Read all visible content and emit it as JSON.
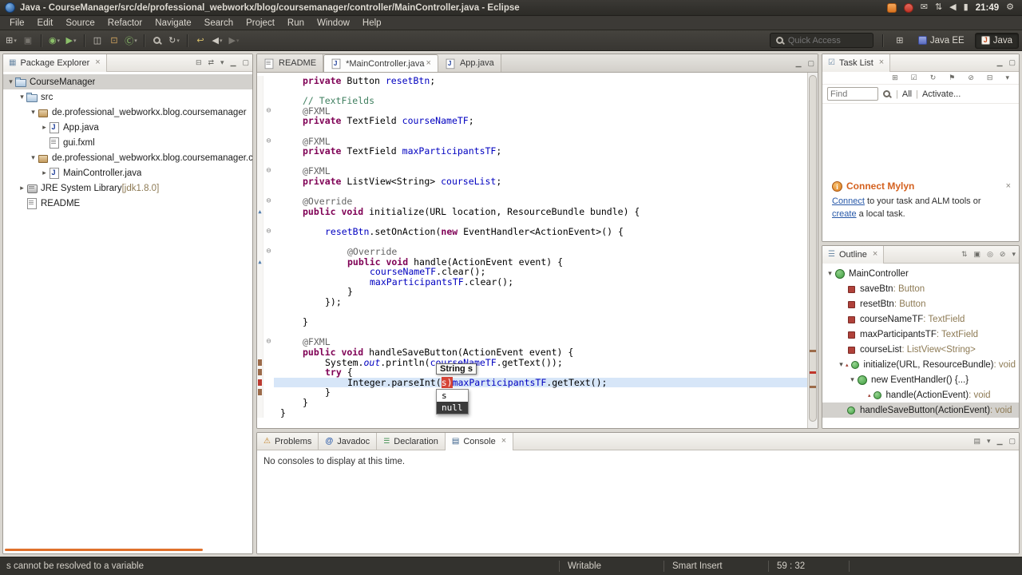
{
  "window": {
    "title": "Java - CourseManager/src/de/professional_webworkx/blog/coursemanager/controller/MainController.java - Eclipse",
    "clock": "21:49"
  },
  "menubar": {
    "items": [
      "File",
      "Edit",
      "Source",
      "Refactor",
      "Navigate",
      "Search",
      "Project",
      "Run",
      "Window",
      "Help"
    ]
  },
  "toolbar": {
    "quick_access_placeholder": "Quick Access",
    "perspectives": [
      {
        "label": "Java EE"
      },
      {
        "label": "Java"
      }
    ]
  },
  "package_explorer": {
    "title": "Package Explorer",
    "items": [
      {
        "label": "CourseManager",
        "icon": "project",
        "depth": 0,
        "expander": "down",
        "selected": true
      },
      {
        "label": "src",
        "icon": "src",
        "depth": 1,
        "expander": "down"
      },
      {
        "label": "de.professional_webworkx.blog.coursemanager",
        "icon": "package",
        "depth": 2,
        "expander": "down"
      },
      {
        "label": "App.java",
        "icon": "java",
        "depth": 3,
        "expander": "right"
      },
      {
        "label": "gui.fxml",
        "icon": "file",
        "depth": 3
      },
      {
        "label": "de.professional_webworkx.blog.coursemanager.controller",
        "icon": "package",
        "depth": 2,
        "expander": "down"
      },
      {
        "label": "MainController.java",
        "icon": "java",
        "depth": 3,
        "expander": "right"
      },
      {
        "label": "JRE System Library",
        "deco": " [jdk1.8.0]",
        "icon": "library",
        "depth": 1,
        "expander": "right"
      },
      {
        "label": "README",
        "icon": "file",
        "depth": 1
      }
    ]
  },
  "editor": {
    "tabs": [
      {
        "label": "README",
        "icon": "file"
      },
      {
        "label": "*MainController.java",
        "icon": "java",
        "active": true,
        "closable": true
      },
      {
        "label": "App.java",
        "icon": "java"
      }
    ],
    "assist": {
      "tooltip": "String s",
      "items": [
        {
          "label": "s"
        },
        {
          "label": "null",
          "selected": true
        }
      ]
    },
    "lines": [
      {
        "ind": 1,
        "t": [
          [
            "k",
            "private "
          ],
          [
            "pl",
            "Button "
          ],
          [
            "f",
            "resetBtn"
          ],
          [
            "pl",
            ";"
          ]
        ]
      },
      {
        "t": []
      },
      {
        "ind": 1,
        "t": [
          [
            "c",
            "// TextFields"
          ]
        ]
      },
      {
        "ind": 1,
        "fold": true,
        "t": [
          [
            "a",
            "@FXML"
          ]
        ]
      },
      {
        "ind": 1,
        "t": [
          [
            "k",
            "private "
          ],
          [
            "pl",
            "TextField "
          ],
          [
            "f",
            "courseNameTF"
          ],
          [
            "pl",
            ";"
          ]
        ]
      },
      {
        "t": []
      },
      {
        "ind": 1,
        "fold": true,
        "t": [
          [
            "a",
            "@FXML"
          ]
        ]
      },
      {
        "ind": 1,
        "t": [
          [
            "k",
            "private "
          ],
          [
            "pl",
            "TextField "
          ],
          [
            "f",
            "maxParticipantsTF"
          ],
          [
            "pl",
            ";"
          ]
        ]
      },
      {
        "t": []
      },
      {
        "ind": 1,
        "fold": true,
        "t": [
          [
            "a",
            "@FXML"
          ]
        ]
      },
      {
        "ind": 1,
        "t": [
          [
            "k",
            "private "
          ],
          [
            "pl",
            "ListView<String> "
          ],
          [
            "f",
            "courseList"
          ],
          [
            "pl",
            ";"
          ]
        ]
      },
      {
        "t": []
      },
      {
        "ind": 1,
        "fold": true,
        "t": [
          [
            "a",
            "@Override"
          ]
        ]
      },
      {
        "ind": 1,
        "ovr": true,
        "t": [
          [
            "k",
            "public void "
          ],
          [
            "pl",
            "initialize(URL location, ResourceBundle bundle) {"
          ]
        ]
      },
      {
        "t": []
      },
      {
        "ind": 2,
        "fold": true,
        "t": [
          [
            "f",
            "resetBtn"
          ],
          [
            "pl",
            ".setOnAction("
          ],
          [
            "k",
            "new"
          ],
          [
            "pl",
            " EventHandler<ActionEvent>() {"
          ]
        ]
      },
      {
        "t": []
      },
      {
        "ind": 3,
        "fold": true,
        "t": [
          [
            "a",
            "@Override"
          ]
        ]
      },
      {
        "ind": 3,
        "ovr": true,
        "t": [
          [
            "k",
            "public void "
          ],
          [
            "pl",
            "handle(ActionEvent event) {"
          ]
        ]
      },
      {
        "ind": 4,
        "t": [
          [
            "f",
            "courseNameTF"
          ],
          [
            "pl",
            ".clear();"
          ]
        ]
      },
      {
        "ind": 4,
        "t": [
          [
            "f",
            "maxParticipantsTF"
          ],
          [
            "pl",
            ".clear();"
          ]
        ]
      },
      {
        "ind": 3,
        "t": [
          [
            "pl",
            "}"
          ]
        ]
      },
      {
        "ind": 2,
        "t": [
          [
            "pl",
            "});"
          ]
        ]
      },
      {
        "t": []
      },
      {
        "ind": 1,
        "t": [
          [
            "pl",
            "}"
          ]
        ]
      },
      {
        "t": []
      },
      {
        "ind": 1,
        "fold": true,
        "t": [
          [
            "a",
            "@FXML"
          ]
        ]
      },
      {
        "ind": 1,
        "t": [
          [
            "k",
            "public void "
          ],
          [
            "pl",
            "handleSaveButton(ActionEvent event) {"
          ]
        ]
      },
      {
        "ind": 2,
        "ruler": "brown",
        "t": [
          [
            "pl",
            "System."
          ],
          [
            "sf",
            "out"
          ],
          [
            "pl",
            ".println("
          ],
          [
            "f",
            "courseNameTF"
          ],
          [
            "pl",
            ".getText());"
          ]
        ]
      },
      {
        "ind": 2,
        "ruler": "brown",
        "t": [
          [
            "k",
            "try"
          ],
          [
            "pl",
            " {"
          ]
        ]
      },
      {
        "ind": 3,
        "hl": true,
        "ruler": "red",
        "t": [
          [
            "pl",
            "Integer.parseInt("
          ],
          [
            "err",
            "s)"
          ],
          [
            "f",
            "maxParticipantsTF"
          ],
          [
            "pl",
            ".getText();"
          ]
        ]
      },
      {
        "ind": 2,
        "ruler": "brown",
        "t": [
          [
            "pl",
            "}"
          ]
        ]
      },
      {
        "ind": 1,
        "t": [
          [
            "pl",
            "}"
          ]
        ]
      },
      {
        "ind": 0,
        "t": [
          [
            "pl",
            "}"
          ]
        ]
      }
    ]
  },
  "task_list": {
    "title": "Task List",
    "find_placeholder": "Find",
    "all_label": "All",
    "activate_label": "Activate...",
    "mylyn": {
      "title": "Connect Mylyn",
      "segments": [
        {
          "text": "Connect",
          "link": true
        },
        {
          "text": " to your task and ALM tools or ",
          "link": false
        },
        {
          "text": "create",
          "link": true
        },
        {
          "text": " a local task.",
          "link": false
        }
      ]
    }
  },
  "outline": {
    "title": "Outline",
    "items": [
      {
        "label": "MainController",
        "icon": "class",
        "depth": 0,
        "expander": "down"
      },
      {
        "label": "saveBtn",
        "deco": " : Button",
        "icon": "field",
        "depth": 1
      },
      {
        "label": "resetBtn",
        "deco": " : Button",
        "icon": "field",
        "depth": 1
      },
      {
        "label": "courseNameTF",
        "deco": " : TextField",
        "icon": "field",
        "depth": 1
      },
      {
        "label": "maxParticipantsTF",
        "deco": " : TextField",
        "icon": "field",
        "depth": 1
      },
      {
        "label": "courseList",
        "deco": " : ListView<String>",
        "icon": "field",
        "depth": 1
      },
      {
        "label": "initialize(URL, ResourceBundle)",
        "deco": " : void",
        "icon": "method",
        "depth": 1,
        "expander": "down",
        "ovr": true
      },
      {
        "label": "new EventHandler() {...}",
        "icon": "class-anon",
        "depth": 2,
        "expander": "down"
      },
      {
        "label": "handle(ActionEvent)",
        "deco": " : void",
        "icon": "method",
        "depth": 3,
        "ovr": true
      },
      {
        "label": "handleSaveButton(ActionEvent)",
        "deco": " : void",
        "icon": "method",
        "depth": 1,
        "selected": true
      }
    ]
  },
  "console_panel": {
    "tabs": [
      {
        "label": "Problems",
        "icon": "problems"
      },
      {
        "label": "Javadoc",
        "icon": "javadoc"
      },
      {
        "label": "Declaration",
        "icon": "declaration"
      },
      {
        "label": "Console",
        "icon": "console",
        "active": true,
        "closable": true
      }
    ],
    "message": "No consoles to display at this time."
  },
  "statusbar": {
    "message": "s cannot be resolved to a variable",
    "writable": "Writable",
    "insert_mode": "Smart Insert",
    "position": "59 : 32"
  }
}
